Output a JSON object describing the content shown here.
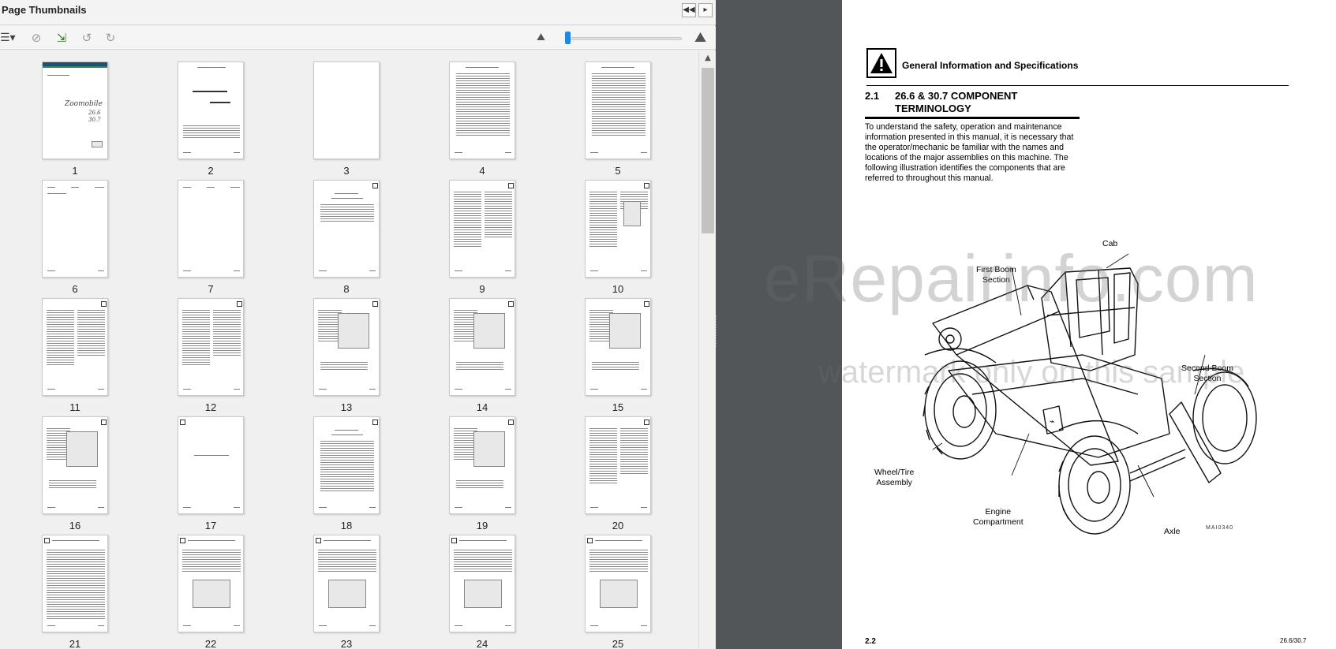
{
  "thumbnails_pane": {
    "title": "Page Thumbnails",
    "collapse_button": "◀◀",
    "options_button": "▸",
    "toolbar": {
      "menu_icon": "thumbnail-options-icon",
      "icons": [
        "delete-pages-icon",
        "insert-pages-icon",
        "rotate-ccw-icon",
        "rotate-cw-icon"
      ]
    },
    "pages": [
      {
        "label": "1"
      },
      {
        "label": "2"
      },
      {
        "label": "3"
      },
      {
        "label": "4"
      },
      {
        "label": "5"
      },
      {
        "label": "6"
      },
      {
        "label": "7"
      },
      {
        "label": "8"
      },
      {
        "label": "9"
      },
      {
        "label": "10"
      },
      {
        "label": "11"
      },
      {
        "label": "12"
      },
      {
        "label": "13"
      },
      {
        "label": "14"
      },
      {
        "label": "15"
      },
      {
        "label": "16"
      },
      {
        "label": "17"
      },
      {
        "label": "18"
      },
      {
        "label": "19"
      },
      {
        "label": "20"
      },
      {
        "label": "21"
      },
      {
        "label": "22"
      },
      {
        "label": "23"
      },
      {
        "label": "24"
      },
      {
        "label": "25"
      }
    ],
    "thumb_1_script": "Zoomobile",
    "thumb_1_model_a": "26.6",
    "thumb_1_model_b": "30.7"
  },
  "document": {
    "header_title": "General Information and Specifications",
    "section_number": "2.1",
    "section_title": "26.6 & 30.7 COMPONENT TERMINOLOGY",
    "body": "To understand the safety, operation and maintenance information presented in this manual, it is necessary that the operator/mechanic be familiar with the names and locations of the major assemblies on this machine. The following illustration identifies the components that are referred to throughout this manual.",
    "callouts": {
      "cab": "Cab",
      "first_boom": "First Boom\nSection",
      "second_boom": "Second Boom\nSection",
      "wheel_tire": "Wheel/Tire\nAssembly",
      "engine": "Engine\nCompartment",
      "axle": "Axle"
    },
    "figure_ref": "MAI0340",
    "page_number": "2.2",
    "model_footer": "26.6/30.7"
  },
  "watermark": {
    "main": "eRepairinfo.com",
    "sub": "watermark only on this sample"
  },
  "colors": {
    "thumb_bg": "#f0f0f0",
    "doc_bg": "#525659",
    "zoom_accent": "#1e88e5"
  }
}
